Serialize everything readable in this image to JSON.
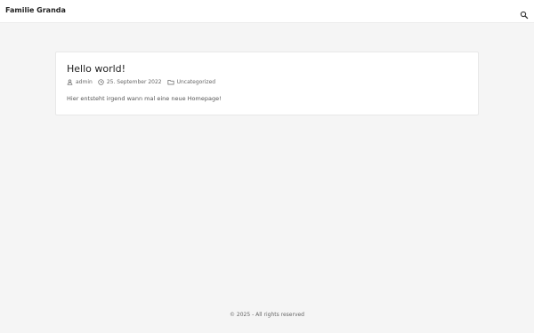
{
  "header": {
    "site_title": "Familie Granda",
    "search_icon": "search-icon"
  },
  "post": {
    "title": "Hello world!",
    "meta": {
      "author": "admin",
      "date": "25. September 2022",
      "category": "Uncategorized",
      "author_icon": "user-icon",
      "date_icon": "clock-icon",
      "category_icon": "folder-icon"
    },
    "excerpt": "Hier entsteht irgend wann mal eine neue Homepage!"
  },
  "footer": {
    "text": "© 2025 - All rights reserved"
  }
}
